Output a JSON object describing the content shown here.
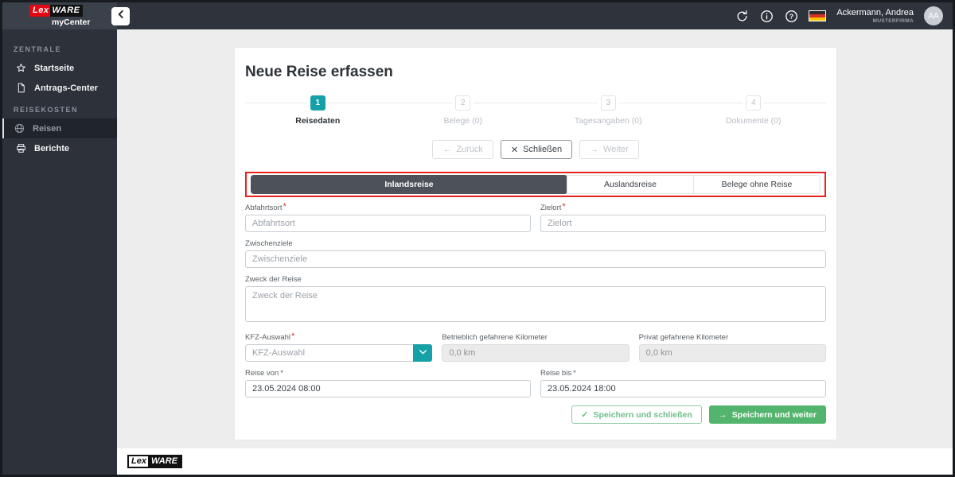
{
  "header": {
    "logo": {
      "lex": "Lex",
      "ware": "WARE",
      "sub": "myCenter"
    },
    "user": {
      "name": "Ackermann, Andrea",
      "company": "MUSTERFIRMA",
      "initials": "AA"
    }
  },
  "sidebar": {
    "sections": [
      {
        "title": "ZENTRALE",
        "items": [
          {
            "label": "Startseite",
            "icon": "star"
          },
          {
            "label": "Antrags-Center",
            "icon": "document"
          }
        ]
      },
      {
        "title": "REISEKOSTEN",
        "items": [
          {
            "label": "Reisen",
            "icon": "globe",
            "active": true
          },
          {
            "label": "Berichte",
            "icon": "printer"
          }
        ]
      }
    ]
  },
  "footer": {
    "logo": {
      "lex": "Lex",
      "ware": "WARE"
    }
  },
  "main": {
    "title": "Neue Reise erfassen",
    "stepper": [
      {
        "number": "1",
        "label": "Reisedaten",
        "active": true
      },
      {
        "number": "2",
        "label": "Belege (0)",
        "active": false
      },
      {
        "number": "3",
        "label": "Tagesangaben (0)",
        "active": false
      },
      {
        "number": "4",
        "label": "Dokumente (0)",
        "active": false
      }
    ],
    "nav_buttons": {
      "back": {
        "icon": "←",
        "label": "Zurück",
        "enabled": false
      },
      "close": {
        "icon": "✕",
        "label": "Schließen",
        "enabled": true
      },
      "next": {
        "icon": "→",
        "label": "Weiter",
        "enabled": false
      }
    },
    "tabs": [
      {
        "label": "Inlandsreise",
        "active": true
      },
      {
        "label": "Auslandsreise",
        "active": false
      },
      {
        "label": "Belege ohne Reise",
        "active": false
      }
    ],
    "form": {
      "required_marker": "*",
      "abfahrtsort": {
        "label": "Abfahrtsort",
        "placeholder": "Abfahrtsort"
      },
      "zielort": {
        "label": "Zielort",
        "placeholder": "Zielort"
      },
      "zwischenziele": {
        "label": "Zwischenziele",
        "placeholder": "Zwischenziele"
      },
      "zweck": {
        "label": "Zweck der Reise",
        "placeholder": "Zweck der Reise"
      },
      "kfz": {
        "label": "KFZ-Auswahl",
        "placeholder": "KFZ-Auswahl"
      },
      "betrieblich_km": {
        "label": "Betrieblich gefahrene Kilometer",
        "value": "0,0 km"
      },
      "privat_km": {
        "label": "Privat gefahrene Kilometer",
        "value": "0,0 km"
      },
      "reise_von": {
        "label": "Reise von",
        "value": "23.05.2024 08:00"
      },
      "reise_bis": {
        "label": "Reise bis",
        "value": "23.05.2024 18:00"
      }
    },
    "save_buttons": {
      "save_close": {
        "icon": "✓",
        "label": "Speichern und schließen"
      },
      "save_next": {
        "icon": "→",
        "label": "Speichern und weiter"
      }
    }
  },
  "colors": {
    "teal_accent": "#16a0a8",
    "green_primary": "#53b56d",
    "brand_red": "#e30613",
    "annotation_red": "#e8231d"
  }
}
